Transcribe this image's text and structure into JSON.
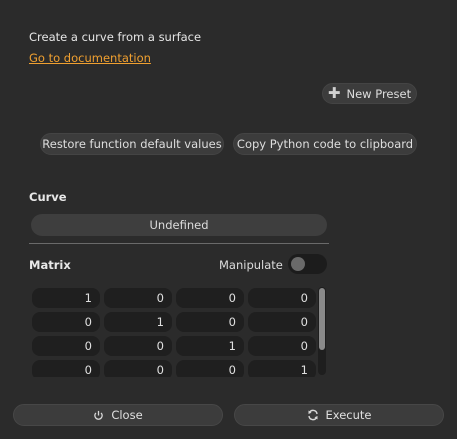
{
  "description": "Create a curve from a surface",
  "doc_link": "Go to documentation",
  "presets": {
    "new_label": "New Preset"
  },
  "actions": {
    "restore_label": "Restore function default values",
    "copy_label": "Copy Python code to clipboard"
  },
  "curve": {
    "label": "Curve",
    "value": "Undefined"
  },
  "matrix": {
    "label": "Matrix",
    "manipulate_label": "Manipulate",
    "manipulate_on": false,
    "rows": [
      [
        "1",
        "0",
        "0",
        "0"
      ],
      [
        "0",
        "1",
        "0",
        "0"
      ],
      [
        "0",
        "0",
        "1",
        "0"
      ],
      [
        "0",
        "0",
        "0",
        "1"
      ]
    ]
  },
  "footer": {
    "close_label": "Close",
    "execute_label": "Execute"
  },
  "icons": {
    "new_preset": "plus-icon",
    "close": "power-icon",
    "execute": "refresh-icon"
  }
}
